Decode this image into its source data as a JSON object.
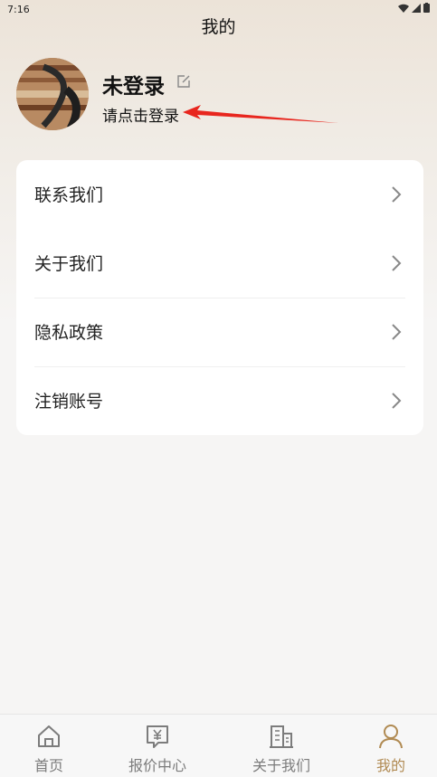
{
  "status": {
    "time": "7:16"
  },
  "header": {
    "title": "我的"
  },
  "profile": {
    "name": "未登录",
    "hint": "请点击登录"
  },
  "menu": [
    {
      "label": "联系我们"
    },
    {
      "label": "关于我们"
    },
    {
      "label": "隐私政策"
    },
    {
      "label": "注销账号"
    }
  ],
  "tabs": [
    {
      "label": "首页",
      "icon": "home-icon"
    },
    {
      "label": "报价中心",
      "icon": "quote-icon"
    },
    {
      "label": "关于我们",
      "icon": "building-icon"
    },
    {
      "label": "我的",
      "icon": "user-icon",
      "active": true
    }
  ],
  "colors": {
    "accent": "#b08a52",
    "arrow": "#e8261e"
  }
}
